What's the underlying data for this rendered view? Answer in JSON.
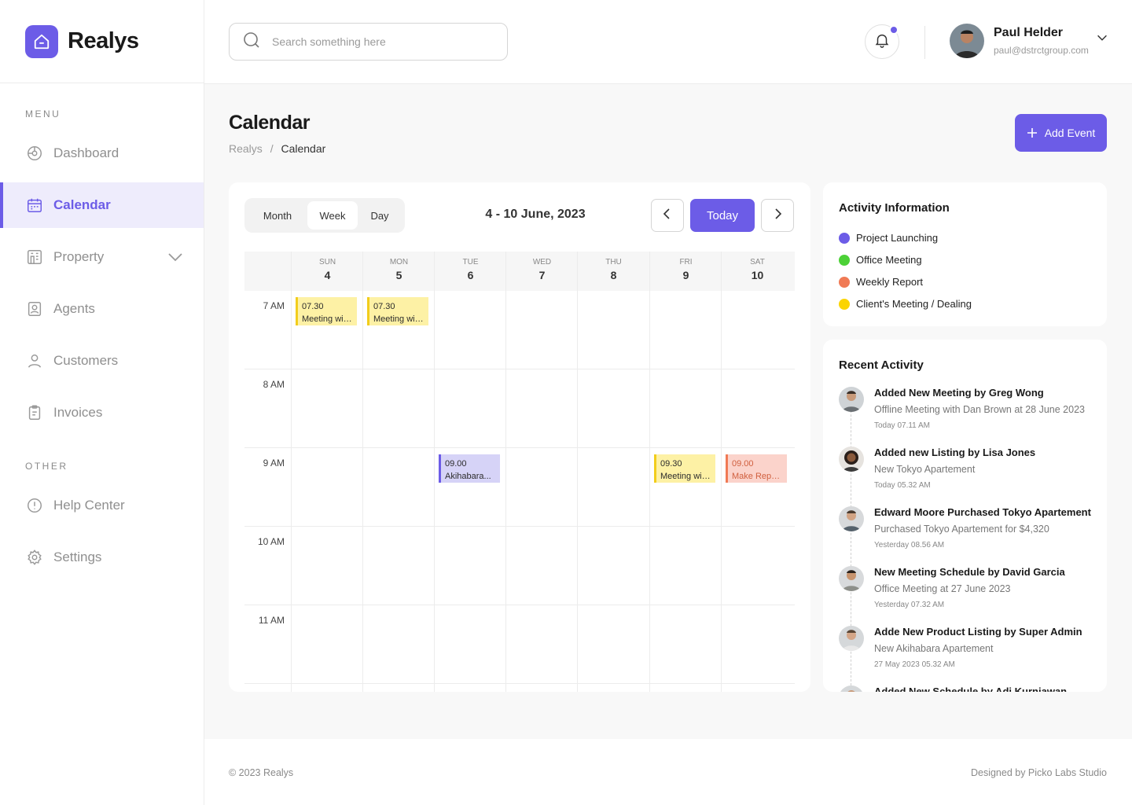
{
  "brand": {
    "name": "Realys",
    "color": "#6c5ce7"
  },
  "search": {
    "placeholder": "Search something here",
    "icon": "search-icon"
  },
  "user": {
    "name": "Paul Helder",
    "email": "paul@dstrctgroup.com"
  },
  "sidebar": {
    "menu_label": "MENU",
    "other_label": "OTHER",
    "items": [
      {
        "label": "Dashboard",
        "icon": "dashboard-icon",
        "active": false
      },
      {
        "label": "Calendar",
        "icon": "calendar-icon",
        "active": true
      },
      {
        "label": "Property",
        "icon": "building-icon",
        "active": false
      },
      {
        "label": "Agents",
        "icon": "agent-badge-icon",
        "active": false
      },
      {
        "label": "Customers",
        "icon": "user-icon",
        "active": false
      },
      {
        "label": "Invoices",
        "icon": "clipboard-icon",
        "active": false
      }
    ],
    "other": [
      {
        "label": "Help Center",
        "icon": "info-icon"
      },
      {
        "label": "Settings",
        "icon": "gear-icon"
      }
    ]
  },
  "page": {
    "title": "Calendar",
    "breadcrumb_root": "Realys",
    "breadcrumb_sep": "/",
    "breadcrumb_current": "Calendar",
    "add_event": "Add Event"
  },
  "calendar": {
    "views": [
      "Month",
      "Week",
      "Day"
    ],
    "active_view": "Week",
    "range": "4 - 10 June, 2023",
    "today": "Today",
    "days": [
      {
        "name": "SUN",
        "num": "4"
      },
      {
        "name": "MON",
        "num": "5"
      },
      {
        "name": "TUE",
        "num": "6"
      },
      {
        "name": "WED",
        "num": "7"
      },
      {
        "name": "THU",
        "num": "8"
      },
      {
        "name": "FRI",
        "num": "9"
      },
      {
        "name": "SAT",
        "num": "10"
      }
    ],
    "times": [
      "7 AM",
      "8 AM",
      "9 AM",
      "10 AM",
      "11 AM"
    ],
    "events": [
      {
        "day": 0,
        "time": "07.30",
        "title": "Meeting with...",
        "type": "client"
      },
      {
        "day": 1,
        "time": "07.30",
        "title": "Meeting with...",
        "type": "client"
      },
      {
        "day": 2,
        "time": "09.00",
        "title": "Akihabara...",
        "type": "project"
      },
      {
        "day": 5,
        "time": "09.30",
        "title": "Meeting with...",
        "type": "client"
      },
      {
        "day": 6,
        "time": "09.00",
        "title": "Make Report...",
        "type": "report"
      }
    ],
    "event_styles": {
      "client": {
        "bg": "#fdf1a5",
        "border": "#f2cd1c",
        "text": "#2b2b2b"
      },
      "project": {
        "bg": "#d6d3f7",
        "border": "#6c5ce7",
        "text": "#2b2b2b"
      },
      "report": {
        "bg": "#fbd3cb",
        "border": "#f07a55",
        "text": "#d05f3e"
      }
    }
  },
  "activity_info": {
    "title": "Activity Information",
    "items": [
      {
        "label": "Project Launching",
        "color": "#6c5ce7"
      },
      {
        "label": "Office Meeting",
        "color": "#4cd137"
      },
      {
        "label": "Weekly Report",
        "color": "#f07a55"
      },
      {
        "label": "Client's Meeting / Dealing",
        "color": "#fbd400"
      }
    ]
  },
  "recent": {
    "title": "Recent Activity",
    "items": [
      {
        "title": "Added New Meeting by Greg Wong",
        "desc": "Offline Meeting with Dan Brown at 28 June 2023",
        "time": "Today 07.11 AM"
      },
      {
        "title": "Added new Listing by Lisa Jones",
        "desc": "New Tokyo Apartement",
        "time": "Today 05.32 AM"
      },
      {
        "title": "Edward Moore Purchased Tokyo Apartement",
        "desc": "Purchased Tokyo Apartement for $4,320",
        "time": "Yesterday 08.56 AM"
      },
      {
        "title": "New Meeting Schedule by David Garcia",
        "desc": "Office Meeting at 27 June 2023",
        "time": "Yesterday 07.32 AM"
      },
      {
        "title": "Adde New Product Listing by Super Admin",
        "desc": "New Akihabara Apartement",
        "time": "27 May 2023 05.32 AM"
      },
      {
        "title": "Added New Schedule by Adi Kurniawan",
        "desc": "",
        "time": ""
      }
    ]
  },
  "footer": {
    "copyright": "© 2023 Realys",
    "designed": "Designed by Picko Labs Studio"
  }
}
